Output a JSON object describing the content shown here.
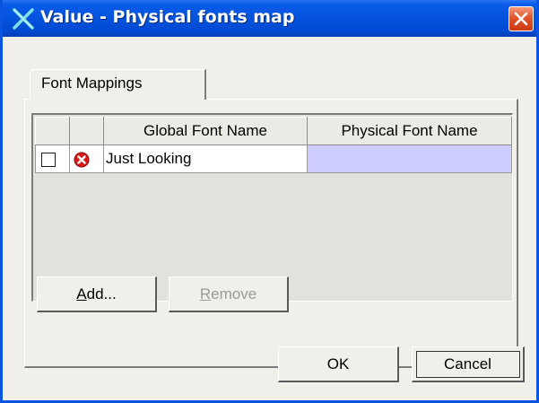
{
  "window": {
    "title": "Value - Physical fonts map",
    "title_icon": "x-logo-icon",
    "close_icon": "close-icon"
  },
  "tabs": [
    {
      "label": "Font Mappings",
      "selected": true
    }
  ],
  "table": {
    "columns": [
      "",
      "",
      "Global Font Name",
      "Physical Font Name"
    ],
    "rows": [
      {
        "checked": false,
        "status_icon": "error-icon",
        "global_font_name": "Just Looking",
        "physical_font_name": ""
      }
    ]
  },
  "buttons": {
    "add": {
      "prefix": "",
      "mnemonic": "A",
      "rest": "dd...",
      "enabled": true
    },
    "remove": {
      "prefix": "",
      "mnemonic": "R",
      "rest": "emove",
      "enabled": false
    },
    "ok": "OK",
    "cancel": "Cancel"
  },
  "colors": {
    "titlebar": "#0453dd",
    "selected_cell": "#ccccff",
    "error_icon": "#d91a1a"
  }
}
